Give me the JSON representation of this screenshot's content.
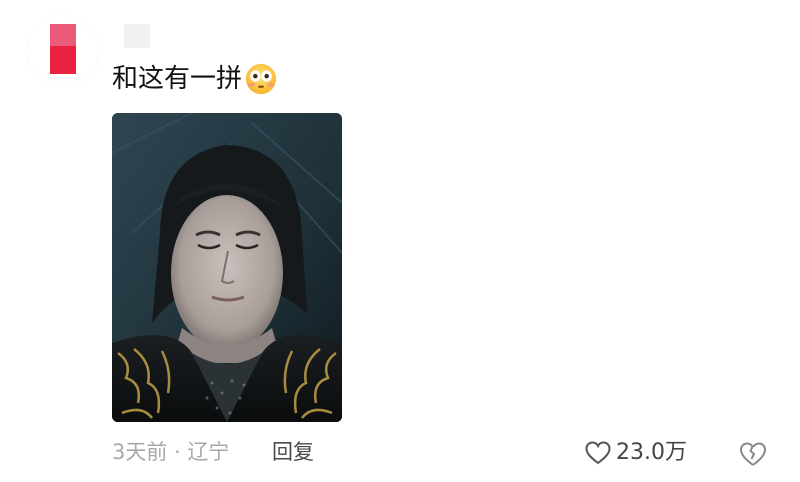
{
  "comment": {
    "text": "和这有一拼",
    "emoji": "flushed-face-emoji",
    "image": "closed-eyes-portrait-photo",
    "time_location": "3天前 · 辽宁",
    "reply_label": "回复",
    "like_count": "23.0万"
  },
  "colors": {
    "avatar_top": "#ec5a7a",
    "avatar_bottom": "#e8223f",
    "meta_text": "#a9a9a9",
    "icon_gray": "#888888"
  }
}
